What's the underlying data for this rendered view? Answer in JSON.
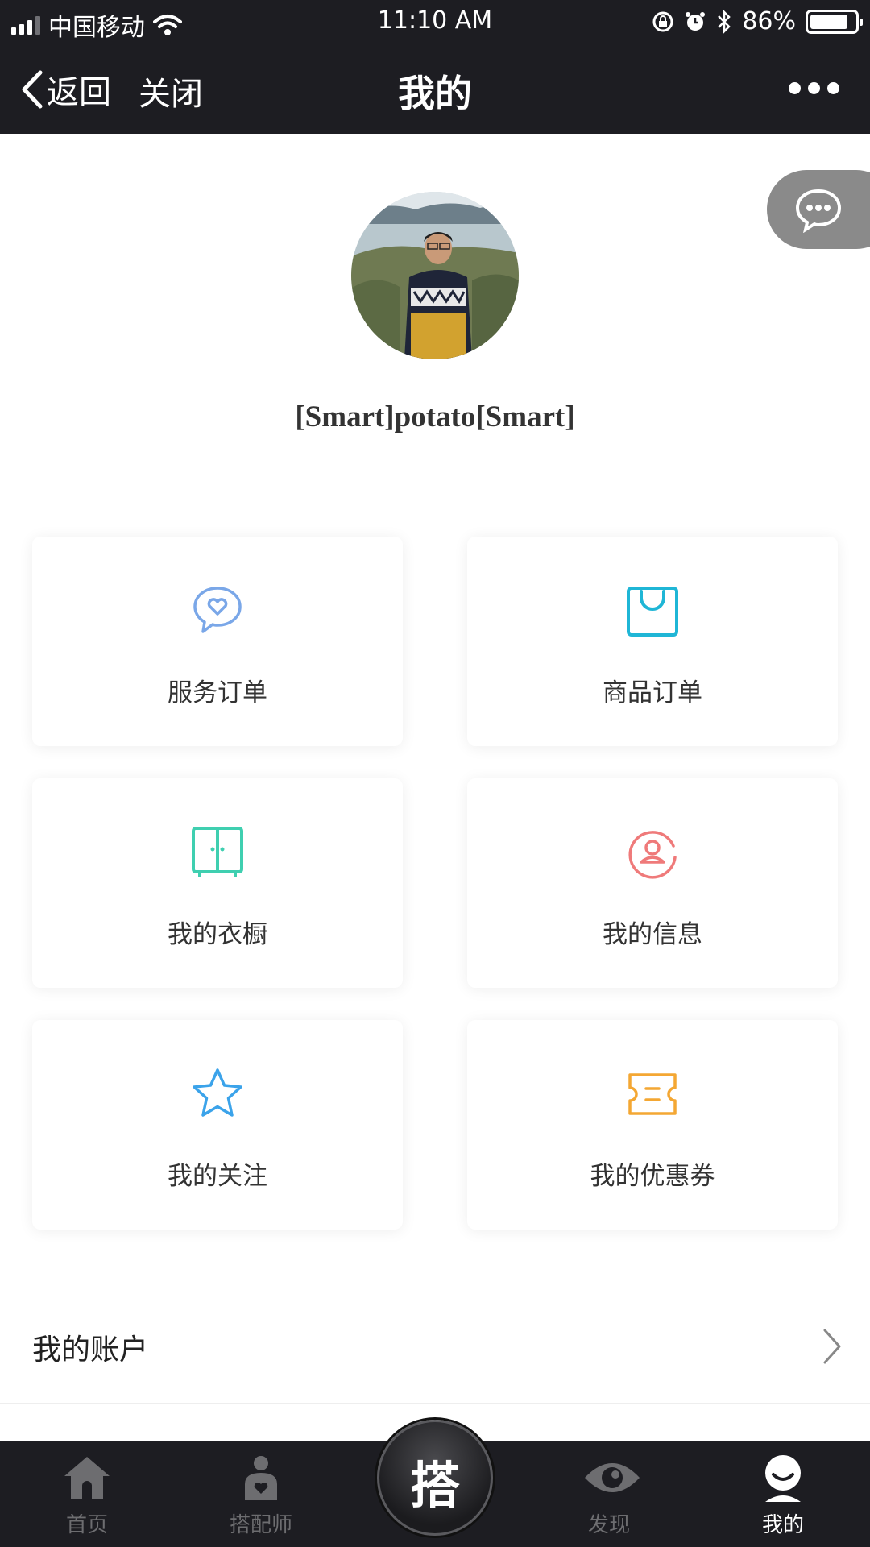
{
  "status_bar": {
    "carrier": "中国移动",
    "time": "11:10 AM",
    "battery_percent": "86%",
    "battery_level": 0.86
  },
  "nav": {
    "back_label": "返回",
    "close_label": "关闭",
    "title": "我的"
  },
  "profile": {
    "username": "[Smart]potato[Smart]"
  },
  "menu": {
    "items": [
      {
        "label": "服务订单",
        "icon": "chat-heart-icon",
        "color": "#7aa7e8"
      },
      {
        "label": "商品订单",
        "icon": "shopping-bag-icon",
        "color": "#1fb6d6"
      },
      {
        "label": "我的衣橱",
        "icon": "wardrobe-icon",
        "color": "#3fcfb0"
      },
      {
        "label": "我的信息",
        "icon": "user-circle-icon",
        "color": "#ef7a7a"
      },
      {
        "label": "我的关注",
        "icon": "star-icon",
        "color": "#3ba3ea"
      },
      {
        "label": "我的优惠券",
        "icon": "coupon-icon",
        "color": "#f4a733"
      }
    ]
  },
  "account": {
    "label": "我的账户"
  },
  "tab_bar": {
    "tabs": [
      {
        "label": "首页",
        "icon": "home-icon"
      },
      {
        "label": "搭配师",
        "icon": "stylist-icon"
      },
      {
        "label": "发现",
        "icon": "eye-icon"
      },
      {
        "label": "我的",
        "icon": "profile-icon",
        "active": true
      }
    ],
    "center_label": "搭"
  }
}
